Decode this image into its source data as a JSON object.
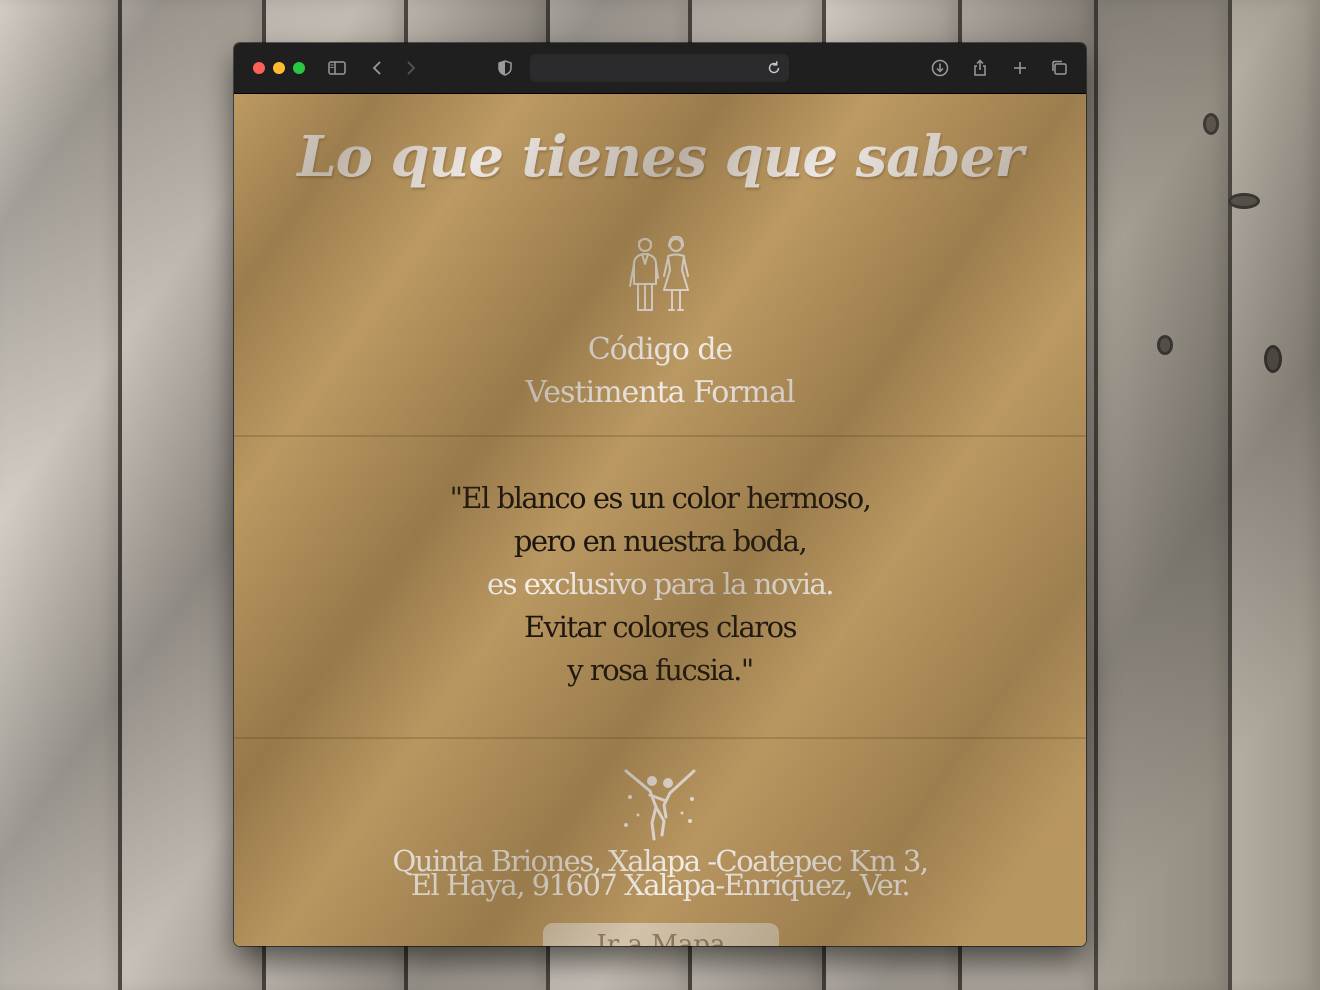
{
  "page": {
    "title": "Lo que tienes que saber",
    "dress_code": {
      "icon": "couple-icon",
      "line1": "Código de",
      "line2": "Vestimenta Formal"
    },
    "quote": {
      "line1": "\"El blanco es un color hermoso,",
      "line2": "pero en nuestra boda,",
      "line3": "es exclusivo para la novia.",
      "line4": "Evitar colores claros",
      "line5": "y rosa fucsia.\""
    },
    "venue": {
      "icon": "dancing-couple-icon",
      "address_line1": "Quinta Briones, Xalapa -Coatepec Km 3,",
      "address_line2": "El Haya, 91607 Xalapa-Enríquez, Ver.",
      "map_button": "Ir a Mapa"
    }
  },
  "browser": {
    "toolbar_icons": [
      "sidebar-icon",
      "back-icon",
      "forward-icon",
      "shield-icon",
      "reload-icon",
      "download-icon",
      "share-icon",
      "new-tab-icon",
      "tabs-overview-icon"
    ]
  },
  "colors": {
    "background": "#b9975f",
    "title": "#ece6e2",
    "quote_text": "#1a1510",
    "highlight_text": "#f4f0ec"
  }
}
